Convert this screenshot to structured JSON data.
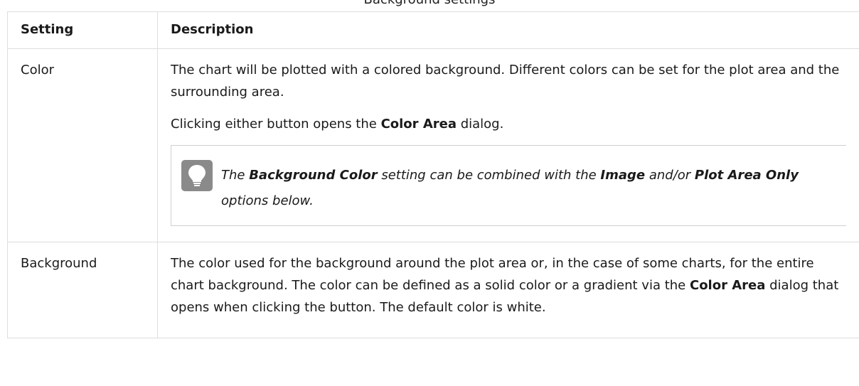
{
  "caption": "Background settings",
  "table": {
    "headers": [
      "Setting",
      "Description"
    ],
    "rows": [
      {
        "setting": "Color",
        "para1": "The chart will be plotted with a colored background. Different colors can be set for the plot area and the surrounding area.",
        "para2": {
          "pre": "Clicking either button opens the ",
          "bold": "Color Area",
          "post": " dialog."
        },
        "note": {
          "t1": "The ",
          "b1": "Background Color",
          "t2": " setting can be combined with the ",
          "b2": "Image",
          "t3": " and/or ",
          "b3": "Plot Area Only",
          "t4": " options below."
        }
      },
      {
        "setting": "Background",
        "pre": "The color used for the background around the plot area or, in the case of some charts, for the entire chart background. The color can be defined as a solid color or a gradient via the ",
        "bold": "Color Area",
        "post": " dialog that opens when clicking the button. The default color is white."
      }
    ]
  },
  "icons": {
    "note": "lightbulb-icon"
  },
  "colors": {
    "border": "#dedede",
    "note_icon_bg": "#8a8a8a"
  }
}
